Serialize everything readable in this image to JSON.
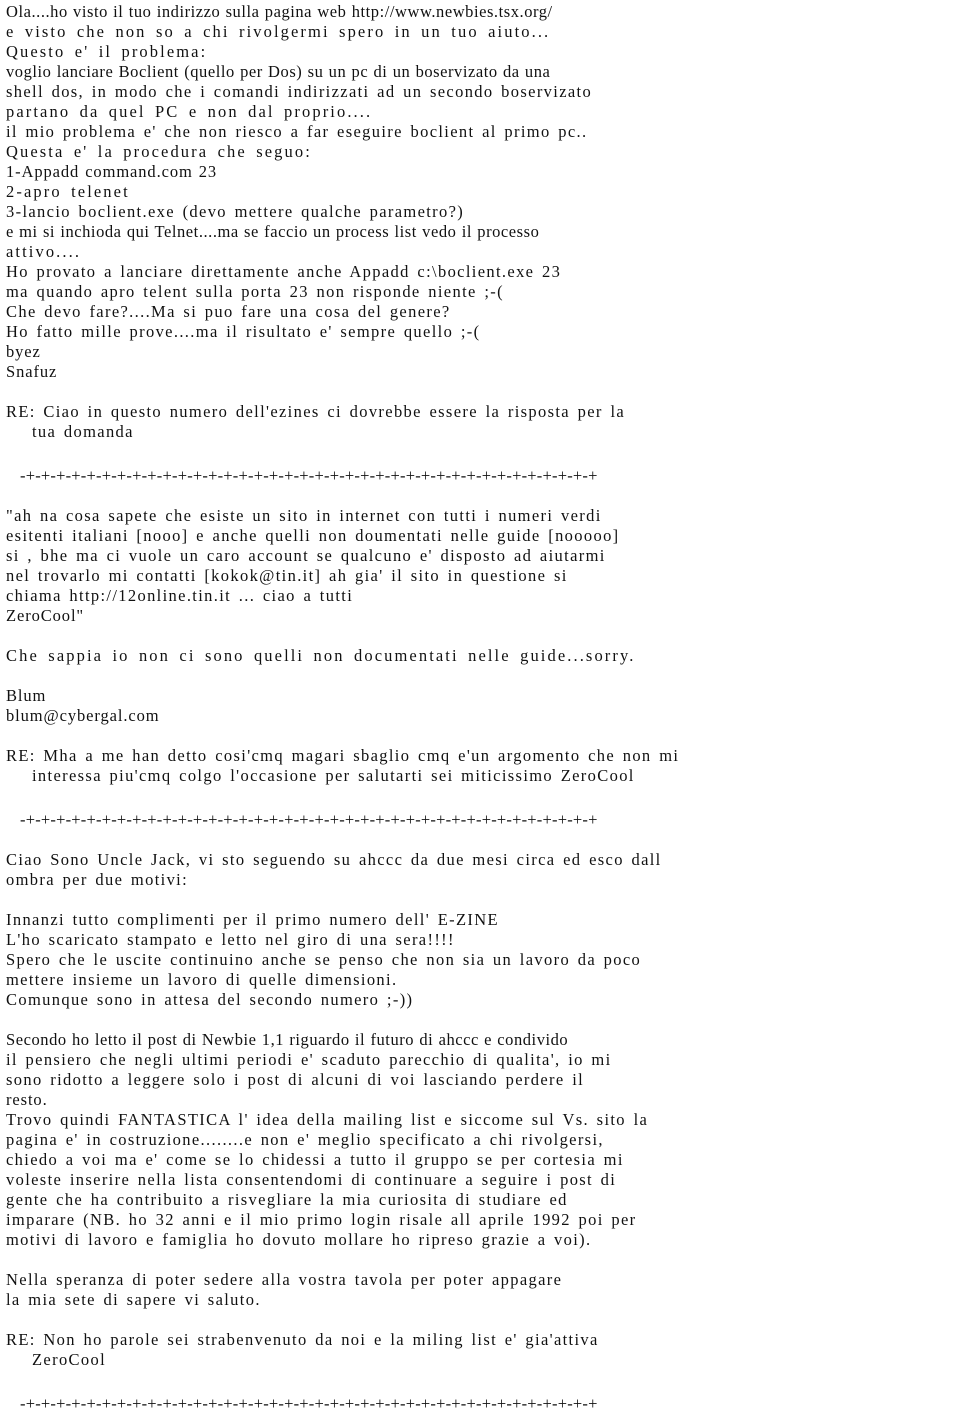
{
  "document": {
    "kind": "text-page",
    "language": "Italian",
    "background_color": "#ffffff",
    "text_color": "#111111",
    "separator_rule": "-+-+-+-+-+-+-+-+-+-+-+-+-+-+-+-+-+-+-+-+-+-+-+-+-+-+-+-+-+-+-+-+-+-+-+-+-+-+"
  },
  "blocks": [
    {
      "id": "message-1-question",
      "name": "snafuz-question",
      "lines": [
        "Ola....ho visto il tuo indirizzo sulla pagina web http://www.newbies.tsx.org/",
        "e visto che non so a chi rivolgermi spero in un tuo aiuto...",
        "Questo e' il problema:",
        "voglio lanciare Boclient (quello per Dos) su un pc di un boservizato da una",
        "shell dos, in modo che i comandi indirizzati ad un secondo boservizato",
        "partano da quel PC e non dal proprio....",
        "il mio problema e' che non riesco a far eseguire boclient al primo pc..",
        "Questa e' la procedura che seguo:",
        "1-Appadd command.com 23",
        "2-apro telenet",
        "3-lancio boclient.exe (devo mettere qualche parametro?)",
        "e mi si inchioda qui Telnet....ma se faccio un process list vedo il processo",
        "attivo....",
        "Ho provato a lanciare direttamente anche Appadd c:\\boclient.exe 23",
        "ma quando apro telent sulla porta 23 non risponde niente ;-(",
        "Che devo fare?....Ma si puo fare una cosa del genere?",
        "Ho fatto mille prove....ma il risultato e' sempre quello ;-(",
        "byez",
        "Snafuz"
      ]
    },
    {
      "id": "message-1-reply",
      "name": "reply-to-snafuz",
      "prefix": "RE:",
      "lines": [
        "RE: Ciao in questo numero dell'ezines ci dovrebbe essere la risposta per la",
        "tua domanda"
      ]
    },
    {
      "id": "message-2-question",
      "name": "zerocool-quote",
      "lines": [
        "\"ah na cosa sapete che esiste un sito in internet con tutti i numeri verdi",
        "esitenti italiani [nooo] e anche quelli non doumentati nelle guide [nooooo]",
        "si , bhe ma ci vuole un caro account se qualcuno e' disposto ad aiutarmi",
        "nel trovarlo mi contatti [kokok@tin.it] ah gia' il sito in questione si",
        "chiama http://12online.tin.it ... ciao a tutti",
        "ZeroCool\""
      ]
    },
    {
      "id": "message-2-answer",
      "name": "blum-answer",
      "lines": [
        "Che sappia io non ci sono quelli non documentati nelle guide...sorry.",
        "Blum",
        "blum@cybergal.com"
      ]
    },
    {
      "id": "message-2-reply",
      "name": "reply-to-blum",
      "prefix": "RE:",
      "lines": [
        "RE: Mha a me han detto cosi'cmq magari sbaglio cmq e'un argomento che non mi",
        "interessa piu'cmq colgo l'occasione per salutarti sei miticissimo ZeroCool"
      ]
    },
    {
      "id": "message-3-question",
      "name": "uncle-jack-letter",
      "lines": [
        "Ciao Sono Uncle Jack, vi sto seguendo su ahccc da due mesi circa ed esco dall",
        "ombra per due motivi:",
        "Innanzi tutto complimenti per il primo numero dell' E-ZINE",
        "L'ho scaricato stampato e letto nel giro di una sera!!!!",
        "Spero che le uscite continuino anche se penso che non sia un lavoro da poco",
        "mettere insieme un lavoro di quelle dimensioni.",
        "Comunque sono in attesa del secondo numero ;-))",
        "Secondo ho letto il post di Newbie 1,1 riguardo il futuro di ahccc e condivido",
        "il pensiero che negli ultimi periodi e' scaduto parecchio di qualita', io mi",
        "sono ridotto a leggere solo i post di alcuni di voi lasciando perdere il",
        "resto.",
        "Trovo quindi FANTASTICA l' idea della mailing list e siccome sul Vs. sito la",
        "pagina e' in costruzione........e non e' meglio specificato a chi rivolgersi,",
        "chiedo a voi ma e' come se lo chidessi a tutto il gruppo se per cortesia mi",
        "voleste inserire nella lista consentendomi di continuare a seguire i post di",
        "gente che ha contribuito a risvegliare la mia curiosita di studiare ed",
        "imparare (NB. ho 32 anni e il mio primo login risale all aprile 1992 poi per",
        "motivi di lavoro e famiglia ho dovuto mollare ho ripreso grazie a voi).",
        "Nella speranza di poter sedere alla vostra tavola per poter appagare",
        "la mia sete di sapere vi saluto."
      ]
    },
    {
      "id": "message-3-reply",
      "name": "reply-to-uncle-jack",
      "prefix": "RE:",
      "lines": [
        "RE: Non ho parole sei strabenvenuto da noi e la miling list e' gia'attiva",
        "ZeroCool"
      ]
    }
  ],
  "lines": {
    "l1": "Ola....ho visto il tuo indirizzo sulla pagina web http://www.newbies.tsx.org/",
    "l2": "e visto che non so a chi rivolgermi spero in un tuo aiuto...",
    "l3": "Questo e' il problema:",
    "l4": "voglio lanciare Boclient (quello per Dos) su un pc di un boservizato da una",
    "l5": "shell dos, in modo che i comandi indirizzati ad un secondo boservizato",
    "l6": "partano da quel PC e non dal proprio....",
    "l7": "il mio problema e' che non riesco a far eseguire boclient al primo pc..",
    "l8": "Questa e' la procedura che seguo:",
    "l9": "1-Appadd command.com 23",
    "l10": "2-apro telenet",
    "l11": "3-lancio boclient.exe (devo mettere qualche parametro?)",
    "l12": "e mi si inchioda qui Telnet....ma se faccio un process list vedo il processo",
    "l13": "attivo....",
    "l14": "Ho provato a lanciare direttamente anche Appadd c:\\boclient.exe 23",
    "l15": "ma quando apro telent sulla porta 23 non risponde niente ;-(",
    "l16": "Che devo fare?....Ma si puo fare una cosa del genere?",
    "l17": "Ho fatto mille prove....ma il risultato e' sempre quello ;-(",
    "l18": "byez",
    "l19": "Snafuz",
    "l20": "RE: Ciao in questo numero dell'ezines ci dovrebbe essere la risposta per la",
    "l21": "tua domanda",
    "sep1": "-+-+-+-+-+-+-+-+-+-+-+-+-+-+-+-+-+-+-+-+-+-+-+-+-+-+-+-+-+-+-+-+-+-+-+-+-+-+",
    "l22": "\"ah na cosa sapete che esiste un sito in internet con tutti i numeri verdi",
    "l23": "esitenti italiani [nooo] e anche quelli non doumentati nelle guide [nooooo]",
    "l24": "si , bhe ma ci vuole un caro account se qualcuno e' disposto ad aiutarmi",
    "l25": "nel trovarlo mi contatti [kokok@tin.it] ah gia' il sito in questione si",
    "l26": "chiama http://12online.tin.it ... ciao a tutti",
    "l27": "ZeroCool\"",
    "l28": "Che sappia io non ci sono quelli non documentati nelle guide...sorry.",
    "l29": "Blum",
    "l30": "blum@cybergal.com",
    "l31": "RE: Mha a me han detto cosi'cmq magari sbaglio cmq e'un argomento che non mi",
    "l32": "interessa piu'cmq colgo l'occasione per salutarti sei miticissimo ZeroCool",
    "sep2": "-+-+-+-+-+-+-+-+-+-+-+-+-+-+-+-+-+-+-+-+-+-+-+-+-+-+-+-+-+-+-+-+-+-+-+-+-+-+",
    "l33": "Ciao Sono Uncle Jack, vi sto seguendo su ahccc da due mesi circa ed esco dall",
    "l34": "ombra per due motivi:",
    "l35": "Innanzi tutto complimenti per il primo numero dell' E-ZINE",
    "l36": "L'ho scaricato stampato e letto nel giro di una sera!!!!",
    "l37": "Spero che le uscite continuino anche se penso che non sia un lavoro da poco",
    "l38": "mettere insieme un lavoro di quelle dimensioni.",
    "l39": "Comunque sono in attesa del secondo numero ;-))",
    "l40": "Secondo ho letto il post di Newbie 1,1 riguardo il futuro di ahccc e condivido",
    "l41": "il pensiero che negli ultimi periodi e' scaduto parecchio di qualita', io mi",
    "l42": "sono ridotto a leggere solo i post di alcuni di voi lasciando perdere il",
    "l43": "resto.",
    "l44": "Trovo quindi FANTASTICA l' idea della mailing list e siccome sul Vs. sito la",
    "l45": "pagina e' in costruzione........e non e' meglio specificato a chi rivolgersi,",
    "l46": "chiedo a voi ma e' come se lo chidessi a tutto il gruppo se per cortesia mi",
    "l47": "voleste inserire nella lista consentendomi di continuare a seguire i post di",
    "l48": "gente che ha contribuito a risvegliare la mia curiosita di studiare ed",
    "l49": "imparare (NB. ho 32 anni e il mio primo login risale all aprile 1992 poi per",
    "l50": "motivi di lavoro e famiglia ho dovuto mollare ho ripreso grazie a voi).",
    "l51": "Nella speranza di poter sedere alla vostra tavola per poter appagare",
    "l52": "la mia sete di sapere vi saluto.",
    "l53": "RE: Non ho parole sei strabenvenuto da noi e la miling list e' gia'attiva",
    "l54": "ZeroCool",
    "sep3": "-+-+-+-+-+-+-+-+-+-+-+-+-+-+-+-+-+-+-+-+-+-+-+-+-+-+-+-+-+-+-+-+-+-+-+-+-+-+"
  }
}
